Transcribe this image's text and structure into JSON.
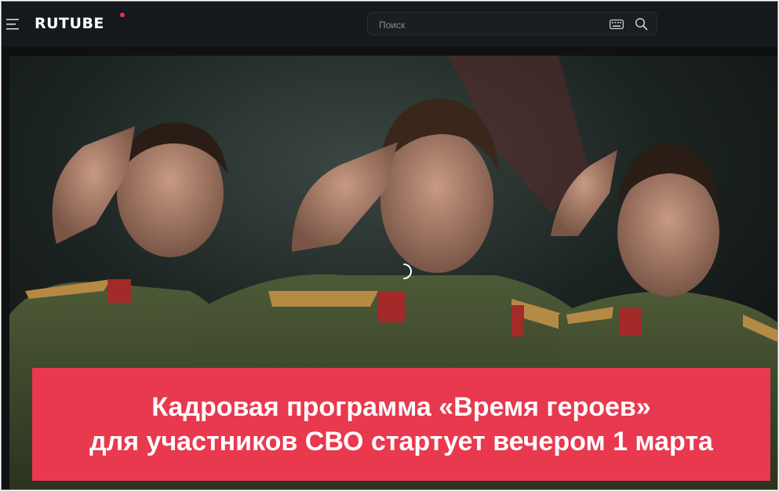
{
  "app": {
    "logo_text": "RUTUBE",
    "accent_color": "#e8304a"
  },
  "header": {
    "menu_icon": "hamburger-menu-icon",
    "search": {
      "placeholder": "Поиск",
      "value": "",
      "keyboard_icon": "keyboard-icon",
      "search_icon": "search-icon"
    }
  },
  "player": {
    "state": "loading",
    "spinner_icon": "loading-spinner-icon",
    "banner": {
      "line1": "Кадровая программа «Время героев»",
      "line2": "для участников СВО стартует вечером 1 марта",
      "background_color": "#e8394f"
    }
  }
}
